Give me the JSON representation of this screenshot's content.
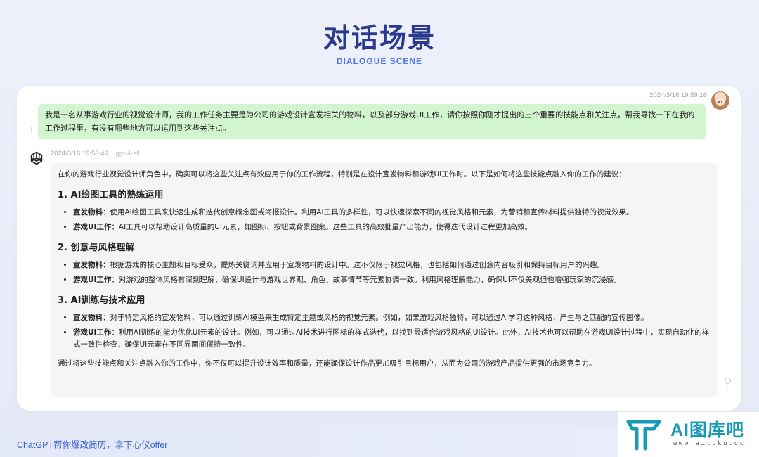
{
  "header": {
    "title": "对话场景",
    "subtitle": "DIALOGUE SCENE"
  },
  "user_message": {
    "timestamp": "2024/3/16 19:59:16",
    "avatar": "user-avatar",
    "text": "我是一名从事游戏行业的视觉设计师，我的工作任务主要是为公司的游戏设计宣发相关的物料，以及部分游戏UI工作，请你按照你刚才提出的三个重要的技能点和关注点，帮我寻找一下在我的工作过程里，有没有哪些地方可以运用到这些关注点。"
  },
  "bot_message": {
    "timestamp": "2024/3/16 19:59:49",
    "model": "gpt-4-all",
    "intro": "在你的游戏行业视觉设计师角色中，确实可以将这些关注点有效应用于你的工作流程，特别是在设计宣发物料和游戏UI工作时。以下是如何将这些技能点融入你的工作的建议：",
    "sections": [
      {
        "heading": "1. AI绘图工具的熟练运用",
        "items": [
          {
            "label": "宣发物料",
            "text": "：使用AI绘图工具来快速生成和迭代创意概念图或海报设计。利用AI工具的多样性，可以快速探索不同的视觉风格和元素，为营销和宣传材料提供独特的视觉效果。"
          },
          {
            "label": "游戏UI工作",
            "text": "：AI工具可以帮助设计高质量的UI元素，如图标、按钮或背景图案。这些工具的高效批量产出能力，使得迭代设计过程更加高效。"
          }
        ]
      },
      {
        "heading": "2. 创意与风格理解",
        "items": [
          {
            "label": "宣发物料",
            "text": "：根据游戏的核心主题和目标受众，提炼关键词并应用于宣发物料的设计中。这不仅限于视觉风格，也包括如何通过创意内容吸引和保持目标用户的兴趣。"
          },
          {
            "label": "游戏UI工作",
            "text": "：对游戏的整体风格有深刻理解，确保UI设计与游戏世界观、角色、故事情节等元素协调一致。利用风格理解能力，确保UI不仅美观但也增强玩家的沉浸感。"
          }
        ]
      },
      {
        "heading": "3. AI训练与技术应用",
        "items": [
          {
            "label": "宣发物料",
            "text": "：对于特定风格的宣发物料，可以通过训练AI模型来生成特定主题或风格的视觉元素。例如，如果游戏风格独特，可以通过AI学习这种风格，产生与之匹配的宣传图像。"
          },
          {
            "label": "游戏UI工作",
            "text": "：利用AI训练的能力优化UI元素的设计。例如，可以通过AI技术进行图标的样式迭代，以找到最适合游戏风格的UI设计。此外，AI技术也可以帮助在游戏UI设计过程中，实现自动化的样式一致性检查，确保UI元素在不同界面间保持一致性。"
          }
        ]
      }
    ],
    "closing": "通过将这些技能点和关注点融入你的工作中，你不仅可以提升设计效率和质量，还能确保设计作品更加吸引目标用户，从而为公司的游戏产品提供更强的市场竞争力。"
  },
  "footer": {
    "text": "ChatGPT帮你爆改简历，拿下心仪offer"
  },
  "watermark": {
    "brand": "AI图库吧",
    "url": "www.aituku.cc",
    "color": "#1a9bb5"
  }
}
